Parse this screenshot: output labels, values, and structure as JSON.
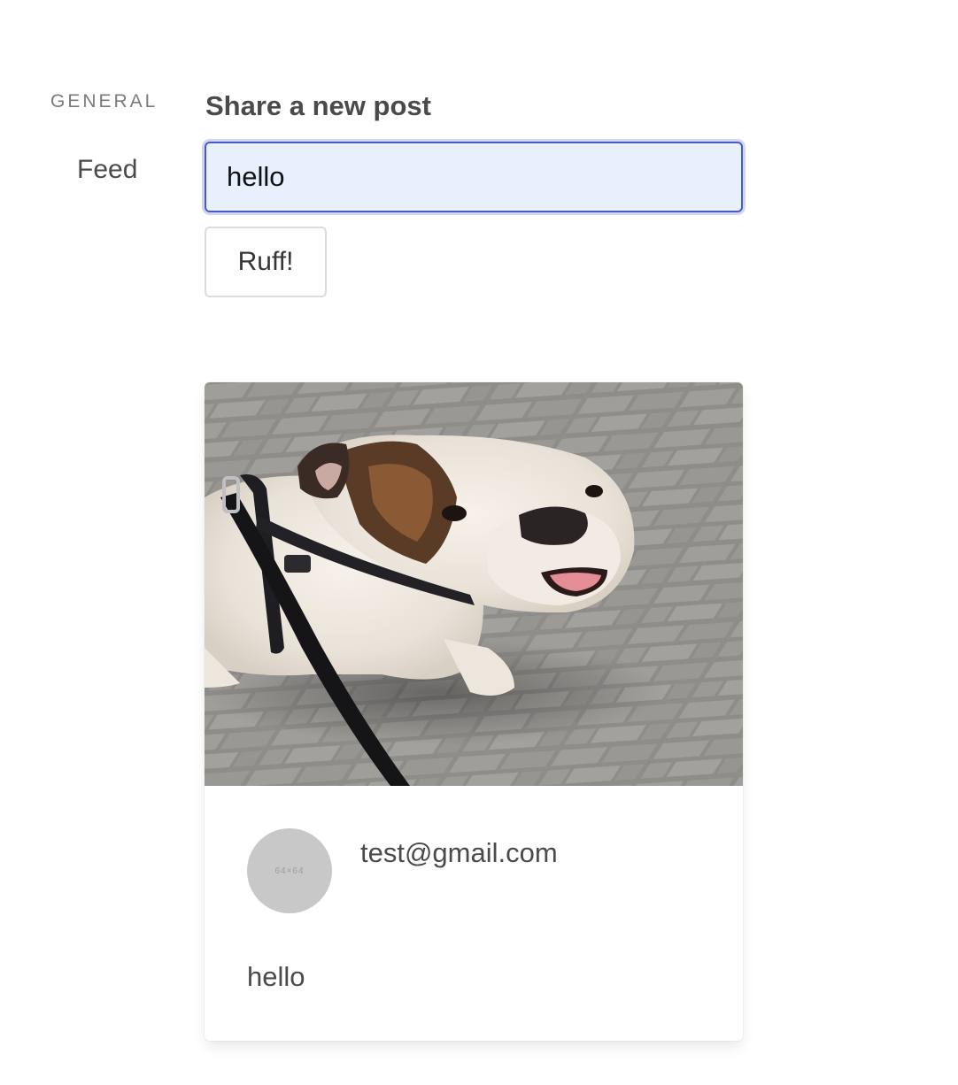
{
  "sidebar": {
    "heading": "GENERAL",
    "items": [
      {
        "label": "Feed"
      }
    ]
  },
  "composer": {
    "title": "Share a new post",
    "input_value": "hello",
    "submit_label": "Ruff!"
  },
  "feed": {
    "posts": [
      {
        "image_icon": "bulldog-photo",
        "avatar_placeholder": "64×64",
        "author": "test@gmail.com",
        "content": "hello"
      }
    ]
  },
  "colors": {
    "input_border": "#4a5cc4",
    "input_background": "#e8f0fe",
    "avatar_background": "#c8c8c8",
    "text": "#4a4a4a"
  }
}
